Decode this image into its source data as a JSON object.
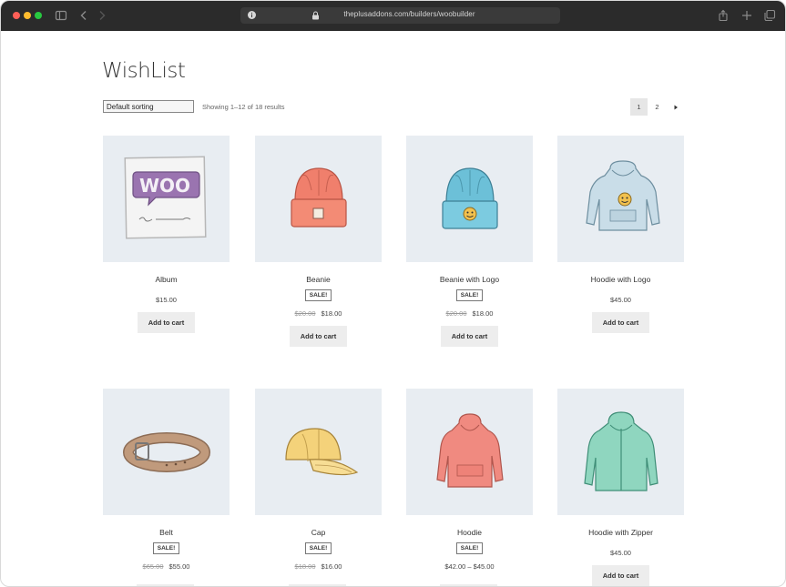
{
  "browser": {
    "url": "theplusaddons.com/builders/woobuilder"
  },
  "page": {
    "title": "WishList",
    "sorting_selected": "Default sorting",
    "result_count": "Showing 1–12 of 18 results",
    "pagination": [
      "1",
      "2"
    ],
    "current_page": "1"
  },
  "products": [
    {
      "name": "Album",
      "sale": false,
      "price": "$15.00",
      "old_price": "",
      "button": "Add to cart",
      "image": "woo-album"
    },
    {
      "name": "Beanie",
      "sale": true,
      "sale_label": "SALE!",
      "old_price": "$20.00",
      "price": "$18.00",
      "button": "Add to cart",
      "image": "beanie-orange"
    },
    {
      "name": "Beanie with Logo",
      "sale": true,
      "sale_label": "SALE!",
      "old_price": "$20.00",
      "price": "$18.00",
      "button": "Add to cart",
      "image": "beanie-blue"
    },
    {
      "name": "Hoodie with Logo",
      "sale": false,
      "price": "$45.00",
      "old_price": "",
      "button": "Add to cart",
      "image": "hoodie-logo"
    },
    {
      "name": "Belt",
      "sale": true,
      "sale_label": "SALE!",
      "old_price": "$65.00",
      "price": "$55.00",
      "button": "",
      "image": "belt"
    },
    {
      "name": "Cap",
      "sale": true,
      "sale_label": "SALE!",
      "old_price": "$18.00",
      "price": "$16.00",
      "button": "",
      "image": "cap"
    },
    {
      "name": "Hoodie",
      "sale": true,
      "sale_label": "SALE!",
      "old_price": "",
      "price": "$42.00 – $45.00",
      "button": "",
      "image": "hoodie-red"
    },
    {
      "name": "Hoodie with Zipper",
      "sale": false,
      "price": "$45.00",
      "old_price": "",
      "button": "Add to cart",
      "image": "hoodie-zipper"
    }
  ],
  "colors": {
    "chrome": "#2b2b2b",
    "thumb_bg": "#e8edf2",
    "button_bg": "#ededed"
  }
}
